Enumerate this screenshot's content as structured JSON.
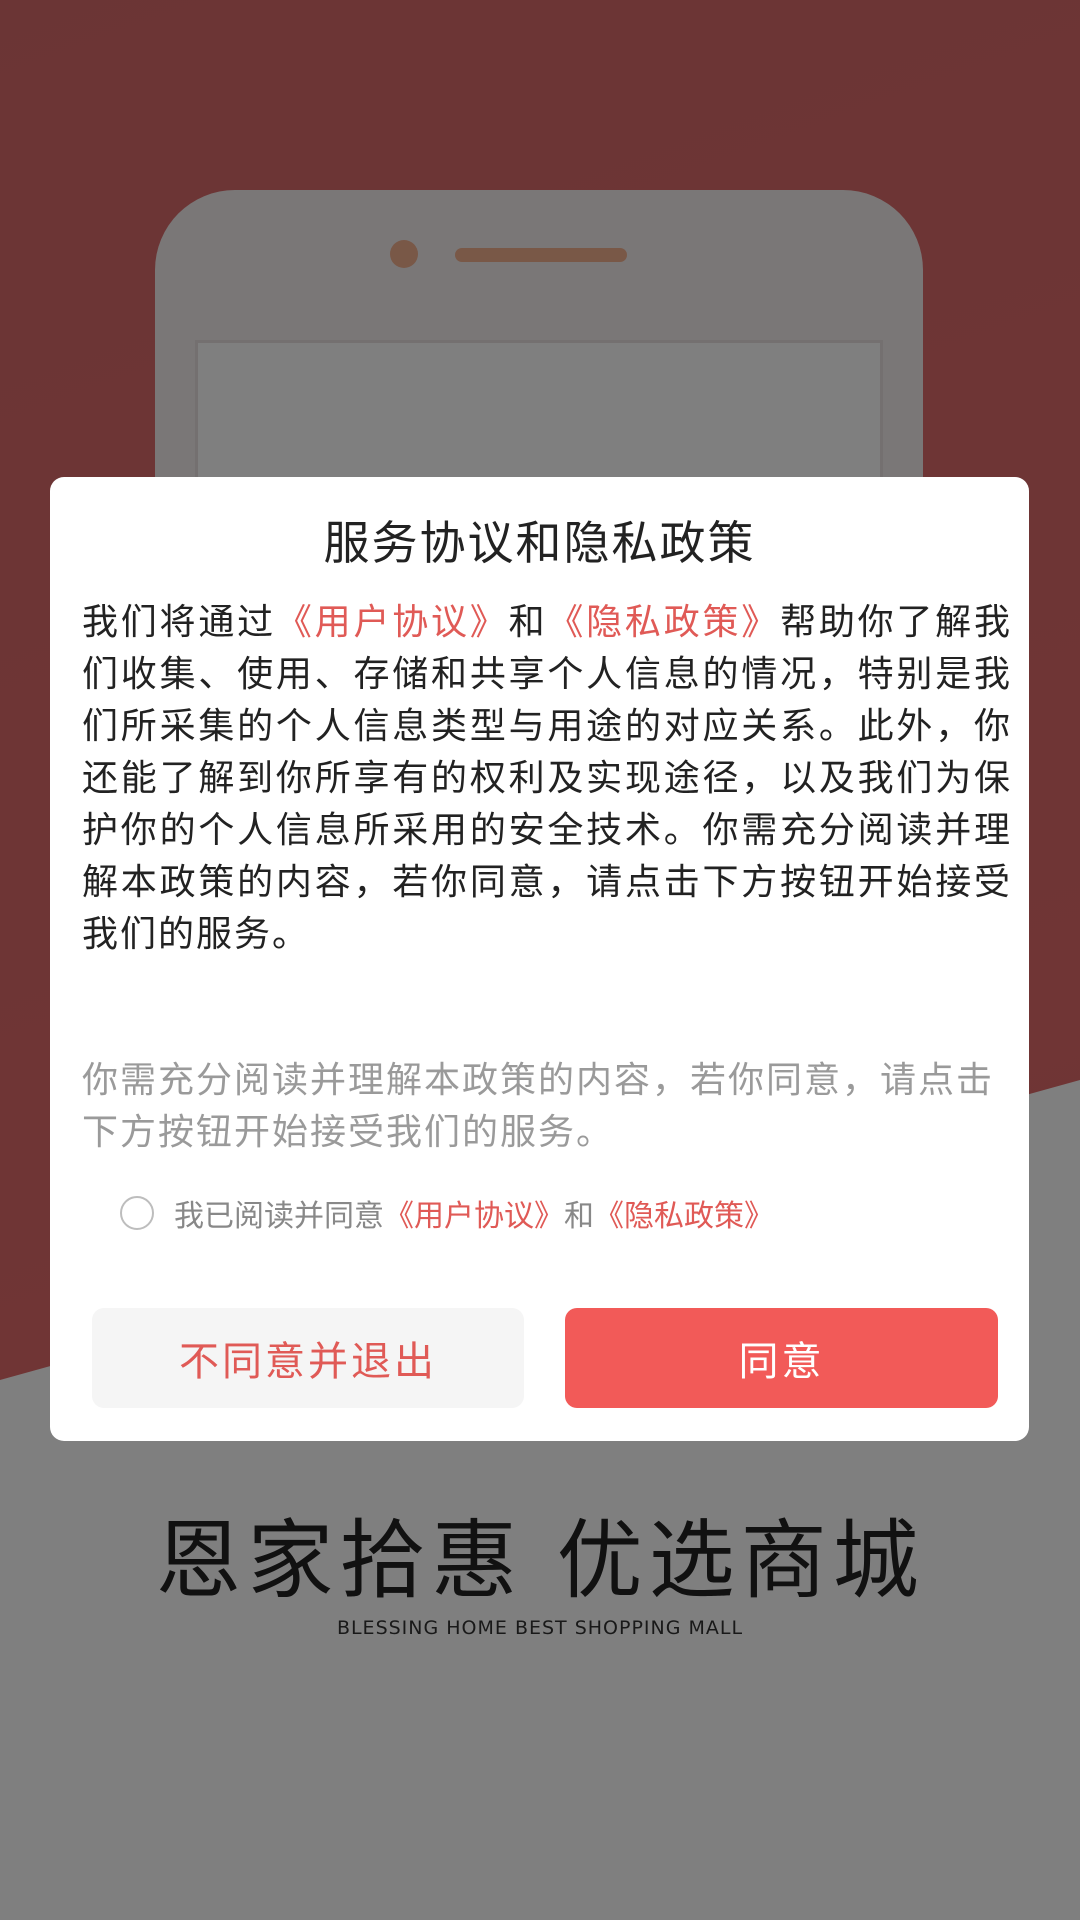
{
  "splash": {
    "brand_title": "恩家拾惠  优选商城",
    "brand_subtitle": "BLESSING HOME BEST SHOPPING MALL"
  },
  "dialog": {
    "title": "服务协议和隐私政策",
    "body": {
      "part1": "我们将通过",
      "user_agreement_link": "《用户协议》",
      "and": "和",
      "privacy_policy_link": "《隐私政策》",
      "part2": "帮助你了解我们收集、使用、存储和共享个人信息的情况，特别是我们所采集的个人信息类型与用途的对应关系。此外，你还能了解到你所享有的权利及实现途径，以及我们为保护你的个人信息所采用的安全技术。你需充分阅读并理解本政策的内容，若你同意，请点击下方按钮开始接受我们的服务。"
    },
    "note": "你需充分阅读并理解本政策的内容，若你同意，请点击下方按钮开始接受我们的服务。",
    "consent": {
      "checked": false,
      "prefix": "我已阅读并同意",
      "user_agreement_link": "《用户协议》",
      "and": "和",
      "privacy_policy_link": "《隐私政策》"
    },
    "buttons": {
      "decline_label": "不同意并退出",
      "accept_label": "同意"
    }
  },
  "colors": {
    "accent": "#f25a58",
    "link": "#e05a56",
    "splash_red": "#e06b6b"
  }
}
